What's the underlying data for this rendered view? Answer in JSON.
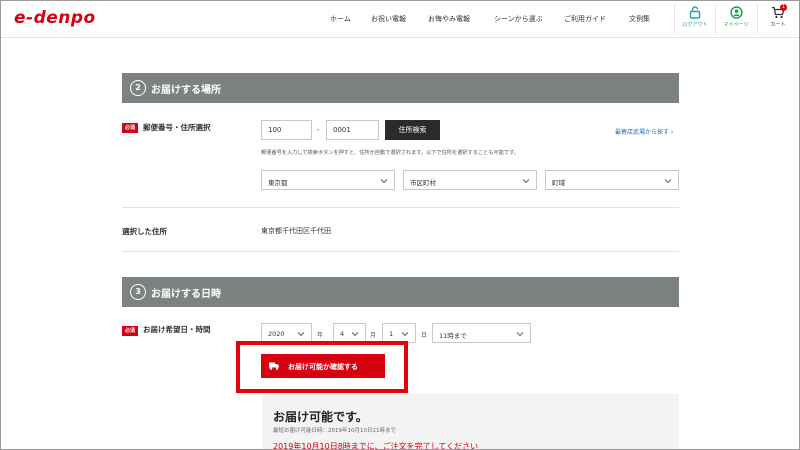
{
  "header": {
    "logo": "e-denpo",
    "nav": [
      "ホーム",
      "お祝い電報",
      "お悔やみ電報",
      "シーンから選ぶ",
      "ご利用ガイド",
      "文例集"
    ],
    "logout_label": "ログアウト",
    "mypage_label": "マイページ",
    "cart_label": "カート",
    "cart_count": "1",
    "colors": {
      "brand": "#d7000f",
      "logout_icon": "#2aa198",
      "mypage_icon": "#16a34a"
    }
  },
  "section_address": {
    "number": "2",
    "title": "お届けする場所",
    "postal": {
      "required_badge": "必須",
      "label": "郵便番号・住所選択",
      "zip1": "100",
      "dash": "-",
      "zip2": "0001",
      "search_button": "住所検索",
      "office_link": "最寄店武場から探す ›",
      "note": "郵便番号を入力して検索ボタンを押すと、住所が自動で選択されます。以下で住所を選択することも可能です。",
      "prefecture": "東京都",
      "city": "市区町村",
      "town": "町域"
    },
    "selected": {
      "label": "選択した住所",
      "value": "東京都千代田区千代田"
    }
  },
  "section_datetime": {
    "number": "3",
    "title": "お届けする日時",
    "required_badge": "必須",
    "label": "お届け希望日・時間",
    "year": "2020",
    "year_unit": "年",
    "month": "4",
    "month_unit": "月",
    "day": "1",
    "day_unit": "日",
    "time": "11時まで",
    "confirm_button": "お届け可能か確認する"
  },
  "result": {
    "title": "お届け可能です。",
    "subtitle": "最短お届け可能日時：2019年10月10日11時まで",
    "deadline": "2019年10月10日8時までに、ご注文を完了してください"
  }
}
